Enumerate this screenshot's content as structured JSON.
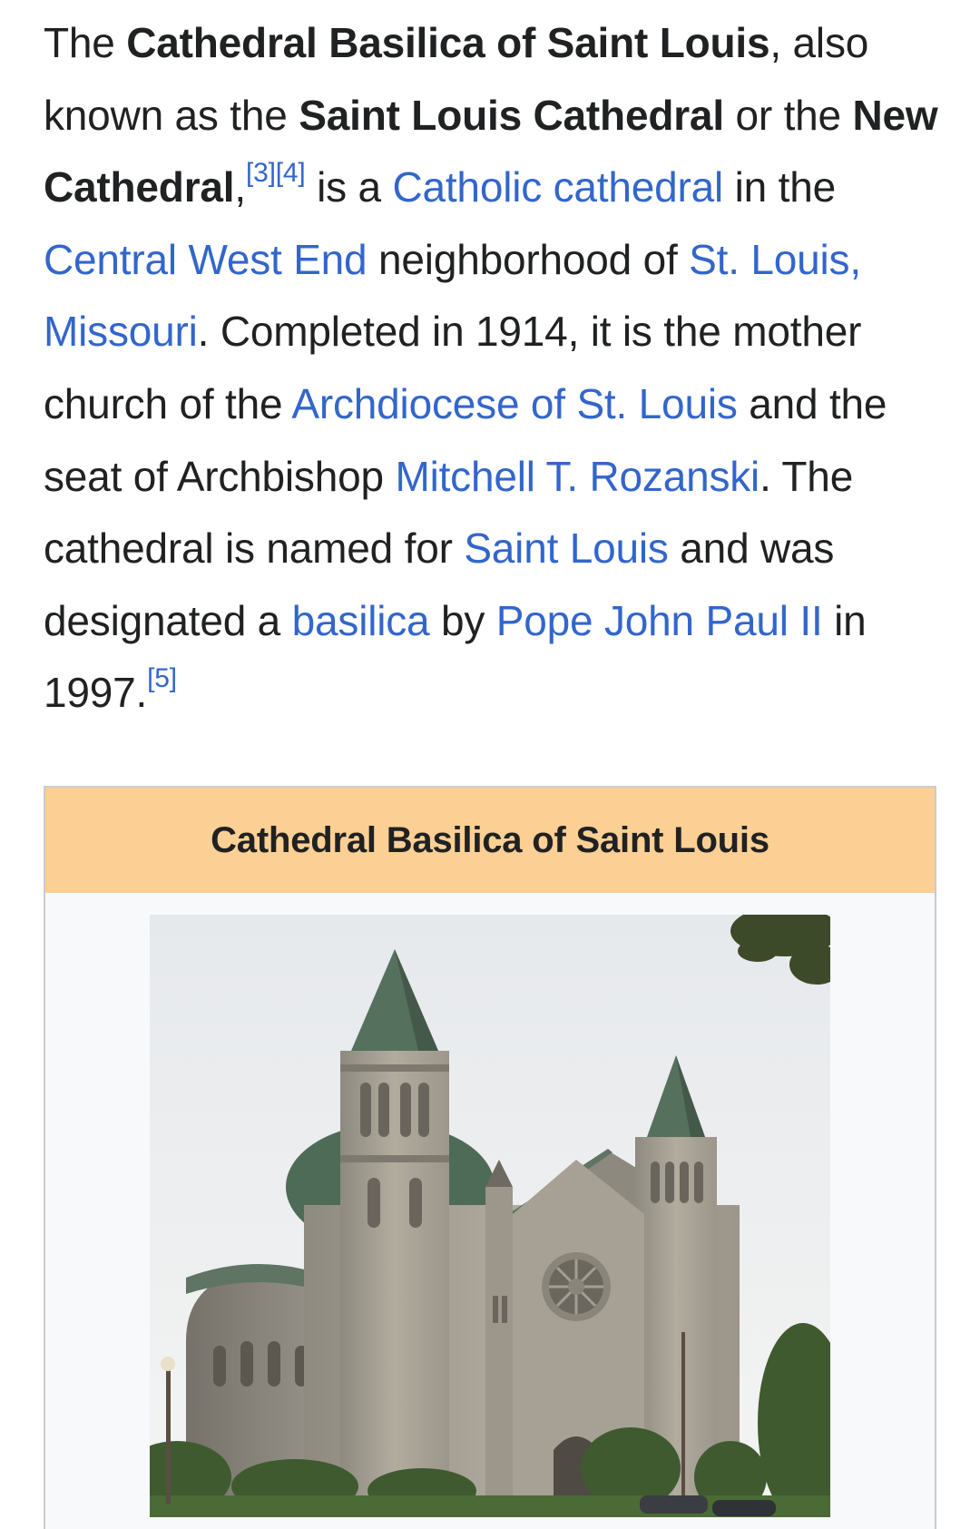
{
  "article": {
    "lead": {
      "s01": "The ",
      "b01": "Cathedral Basilica of Saint Louis",
      "s02": ", also known as the ",
      "b02": "Saint Louis Cathedral",
      "s03": " or the ",
      "b03": "New Cathedral",
      "s04": ",",
      "ref3": "[3]",
      "ref4": "[4]",
      "s05": " is a ",
      "l01": "Catholic cathedral",
      "s06": " in the ",
      "l02": "Central West End",
      "s07": " neighborhood of ",
      "l03": "St. Louis, Missouri",
      "s08": ". Completed in 1914, it is the mother church of the ",
      "l04": "Archdiocese of St. Louis",
      "s09": " and the seat of Archbishop ",
      "l05": "Mitchell T. Rozanski",
      "s10": ". The cathedral is named for ",
      "l06": "Saint Louis",
      "s11": " and was designated a ",
      "l07": "basilica",
      "s12": " by ",
      "l08": "Pope John Paul II",
      "s13": " in 1997.",
      "ref5": "[5]"
    }
  },
  "infobox": {
    "title": "Cathedral Basilica of Saint Louis",
    "image_subject": "cathedral-photo"
  },
  "colors": {
    "link": "#3366cc",
    "text": "#202122",
    "infobox_header": "#fccf94",
    "infobox_bg": "#f8f9fa",
    "border": "#c8ccd1"
  }
}
